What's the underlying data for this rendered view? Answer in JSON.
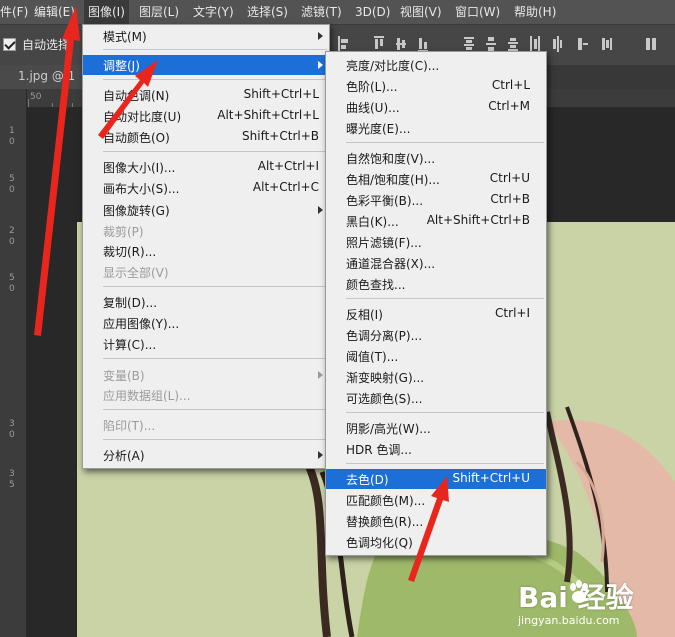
{
  "menubar": {
    "items": [
      {
        "label": "件(F)"
      },
      {
        "label": "编辑(E)"
      },
      {
        "label": "图像(I)"
      },
      {
        "label": "图层(L)"
      },
      {
        "label": "文字(Y)"
      },
      {
        "label": "选择(S)"
      },
      {
        "label": "滤镜(T)"
      },
      {
        "label": "3D(D)"
      },
      {
        "label": "视图(V)"
      },
      {
        "label": "窗口(W)"
      },
      {
        "label": "帮助(H)"
      }
    ]
  },
  "options_bar": {
    "auto_select_label": "自动选择",
    "auto_select_checked": true
  },
  "document": {
    "tab_label": "1.jpg @ 1"
  },
  "ruler": {
    "h_mark": "50",
    "v_marks": [
      "1",
      "0",
      "5",
      "0",
      "2",
      "0",
      "5",
      "0",
      "3",
      "0",
      "3",
      "5"
    ]
  },
  "image_menu": {
    "items": [
      {
        "label": "模式(M)",
        "shortcut": "",
        "submenu": true
      },
      {
        "label": "调整(J)",
        "shortcut": "",
        "submenu": true,
        "highlighted": true
      },
      {
        "label": "自动色调(N)",
        "shortcut": "Shift+Ctrl+L"
      },
      {
        "label": "自动对比度(U)",
        "shortcut": "Alt+Shift+Ctrl+L"
      },
      {
        "label": "自动颜色(O)",
        "shortcut": "Shift+Ctrl+B"
      },
      {
        "label": "图像大小(I)...",
        "shortcut": "Alt+Ctrl+I"
      },
      {
        "label": "画布大小(S)...",
        "shortcut": "Alt+Ctrl+C"
      },
      {
        "label": "图像旋转(G)",
        "shortcut": "",
        "submenu": true
      },
      {
        "label": "裁剪(P)",
        "shortcut": "",
        "disabled": true
      },
      {
        "label": "裁切(R)...",
        "shortcut": ""
      },
      {
        "label": "显示全部(V)",
        "shortcut": "",
        "disabled": true
      },
      {
        "label": "复制(D)...",
        "shortcut": ""
      },
      {
        "label": "应用图像(Y)...",
        "shortcut": ""
      },
      {
        "label": "计算(C)...",
        "shortcut": ""
      },
      {
        "label": "变量(B)",
        "shortcut": "",
        "submenu": true,
        "disabled": true
      },
      {
        "label": "应用数据组(L)...",
        "shortcut": "",
        "disabled": true
      },
      {
        "label": "陷印(T)...",
        "shortcut": "",
        "disabled": true
      },
      {
        "label": "分析(A)",
        "shortcut": "",
        "submenu": true
      }
    ]
  },
  "adjust_menu": {
    "items": [
      {
        "label": "亮度/对比度(C)...",
        "shortcut": ""
      },
      {
        "label": "色阶(L)...",
        "shortcut": "Ctrl+L"
      },
      {
        "label": "曲线(U)...",
        "shortcut": "Ctrl+M"
      },
      {
        "label": "曝光度(E)...",
        "shortcut": ""
      },
      {
        "label": "自然饱和度(V)...",
        "shortcut": ""
      },
      {
        "label": "色相/饱和度(H)...",
        "shortcut": "Ctrl+U"
      },
      {
        "label": "色彩平衡(B)...",
        "shortcut": "Ctrl+B"
      },
      {
        "label": "黑白(K)...",
        "shortcut": "Alt+Shift+Ctrl+B"
      },
      {
        "label": "照片滤镜(F)...",
        "shortcut": ""
      },
      {
        "label": "通道混合器(X)...",
        "shortcut": ""
      },
      {
        "label": "颜色查找...",
        "shortcut": ""
      },
      {
        "label": "反相(I)",
        "shortcut": "Ctrl+I"
      },
      {
        "label": "色调分离(P)...",
        "shortcut": ""
      },
      {
        "label": "阈值(T)...",
        "shortcut": ""
      },
      {
        "label": "渐变映射(G)...",
        "shortcut": ""
      },
      {
        "label": "可选颜色(S)...",
        "shortcut": ""
      },
      {
        "label": "阴影/高光(W)...",
        "shortcut": ""
      },
      {
        "label": "HDR 色调...",
        "shortcut": ""
      },
      {
        "label": "去色(D)",
        "shortcut": "Shift+Ctrl+U",
        "highlighted": true
      },
      {
        "label": "匹配颜色(M)...",
        "shortcut": ""
      },
      {
        "label": "替换颜色(R)...",
        "shortcut": ""
      },
      {
        "label": "色调均化(Q)",
        "shortcut": ""
      }
    ]
  },
  "watermark": {
    "brand": "Bai  经验",
    "url": "jingyan.baidu.com"
  },
  "colors": {
    "highlight": "#1c6fd6",
    "arrow": "#e8261d",
    "canvas": "#c9d3a6",
    "menu_bg": "#efefef"
  }
}
